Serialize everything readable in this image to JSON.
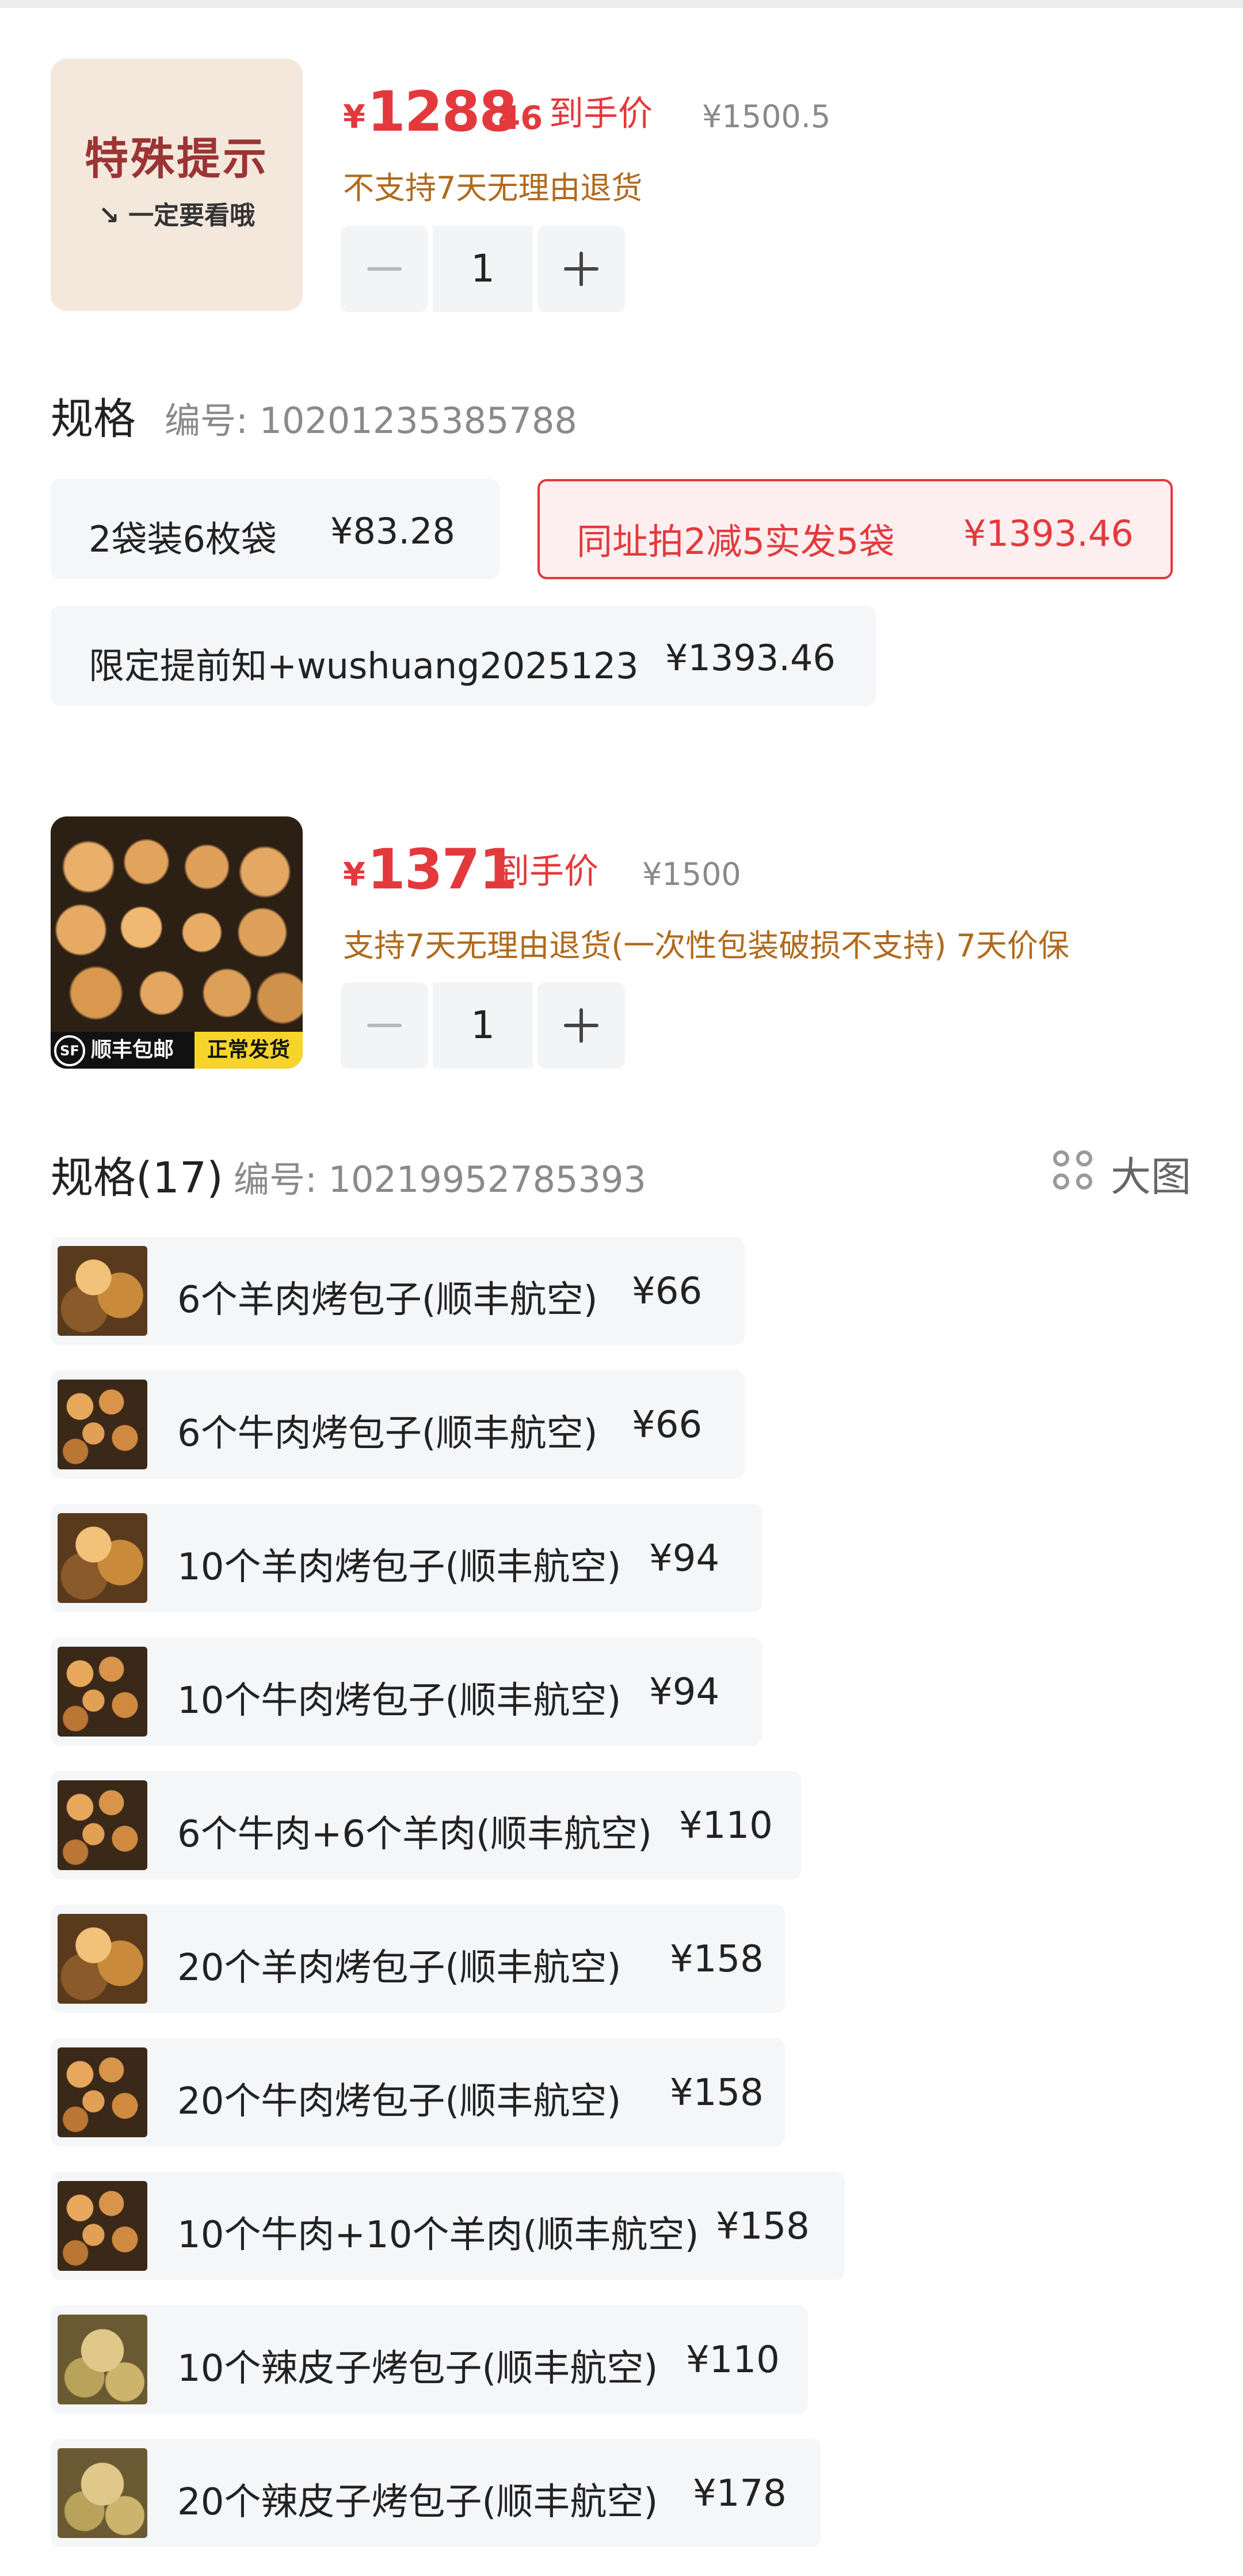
{
  "product1": {
    "notice_title": "特殊提示",
    "notice_sub": "↘ 一定要看哦",
    "currency": "¥",
    "price_int": "1288",
    "price_dec": ".46",
    "price_tag": "到手价",
    "orig_price": "¥1500.5",
    "policy": "不支持7天无理由退货",
    "quantity": "1",
    "spec_label": "规格",
    "spec_code": "编号: 10201235385788",
    "options": [
      {
        "label": "2袋装6枚袋",
        "price": "¥83.28",
        "selected": false
      },
      {
        "label": "同址拍2减5实发5袋",
        "price": "¥1393.46",
        "selected": true
      },
      {
        "label": "限定提前知+wushuang2025123",
        "price": "¥1393.46",
        "selected": false
      }
    ]
  },
  "product2": {
    "currency": "¥",
    "price_int": "1371",
    "price_tag": "到手价",
    "orig_price": "¥1500",
    "policy": "支持7天无理由退货(一次性包装破损不支持) 7天价保",
    "badge_left": "顺丰包邮",
    "badge_logo": "SF",
    "badge_right": "正常发货",
    "quantity": "1",
    "spec_label": "规格(17)",
    "spec_code": "编号: 10219952785393",
    "big_image_label": "大图",
    "items": [
      {
        "label": "6个羊肉烤包子(顺丰航空)",
        "price": "¥66",
        "thumb": "lamb-bun"
      },
      {
        "label": "6个牛肉烤包子(顺丰航空)",
        "price": "¥66",
        "thumb": "tray-buns"
      },
      {
        "label": "10个羊肉烤包子(顺丰航空)",
        "price": "¥94",
        "thumb": "lamb-bun"
      },
      {
        "label": "10个牛肉烤包子(顺丰航空)",
        "price": "¥94",
        "thumb": "tray-buns"
      },
      {
        "label": "6个牛肉+6个羊肉(顺丰航空)",
        "price": "¥110",
        "thumb": "tray-buns"
      },
      {
        "label": "20个羊肉烤包子(顺丰航空)",
        "price": "¥158",
        "thumb": "lamb-bun"
      },
      {
        "label": "20个牛肉烤包子(顺丰航空)",
        "price": "¥158",
        "thumb": "tray-buns"
      },
      {
        "label": "10个牛肉+10个羊肉(顺丰航空)",
        "price": "¥158",
        "thumb": "tray-buns"
      },
      {
        "label": "10个辣皮子烤包子(顺丰航空)",
        "price": "¥110",
        "thumb": "pepper-bun"
      },
      {
        "label": "20个辣皮子烤包子(顺丰航空)",
        "price": "¥178",
        "thumb": "pepper-bun"
      }
    ]
  },
  "colors": {
    "accent": "#e4393c",
    "policy": "#b06a1c",
    "chip_bg": "#f5f6f8"
  }
}
